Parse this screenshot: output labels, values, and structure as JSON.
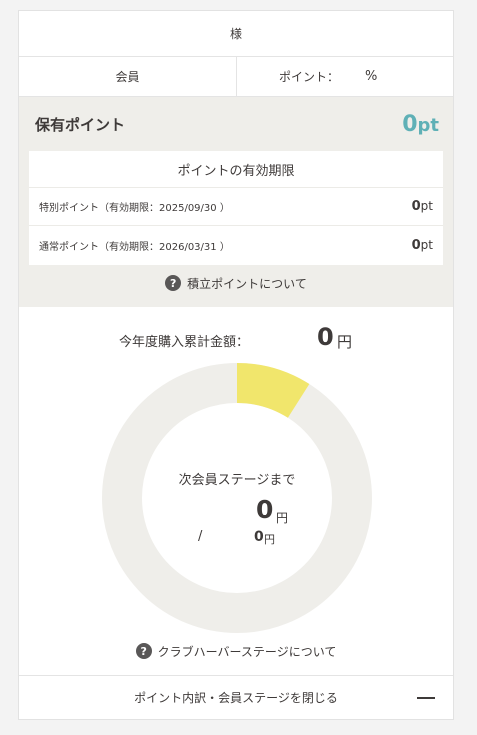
{
  "header": {
    "name": "",
    "honorific": "様"
  },
  "member": {
    "rank_label": "会員",
    "rate_label": "ポイント：",
    "rate_value": "",
    "rate_unit": "%"
  },
  "points": {
    "label": "保有ポイント",
    "value": "0",
    "unit": "pt",
    "expiry_title": "ポイントの有効期限",
    "expiry_items": [
      {
        "label": "特別ポイント（有効期限：2025/09/30 ）",
        "amount": "0",
        "unit": "pt"
      },
      {
        "label": "通常ポイント（有効期限：2026/03/31 ）",
        "amount": "0",
        "unit": "pt"
      }
    ],
    "help_text": "積立ポイントについて"
  },
  "stage": {
    "total_label": "今年度購入累計金額：",
    "total_value": "0",
    "total_unit": "円",
    "next_label": "次会員ステージまで",
    "remaining_value": "0",
    "remaining_unit": "円",
    "slash": "/",
    "target_value": "0",
    "target_unit": "円",
    "progress_fraction": 0.09,
    "progress_color": "#f1e66c",
    "ring_color": "#efeeea",
    "help_text": "クラブハーバーステージについて"
  },
  "footer": {
    "close_label": "ポイント内訳・会員ステージを閉じる"
  },
  "colors": {
    "accent": "#5fb0b6",
    "panel_bg": "#efeeea"
  },
  "icons": {
    "help": "question-circle-icon",
    "collapse": "minus-icon"
  }
}
